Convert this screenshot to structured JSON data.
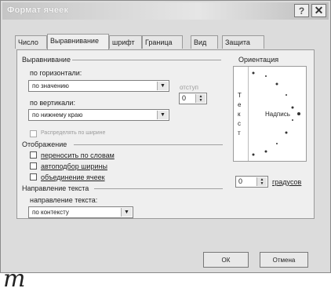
{
  "window": {
    "title": "Формат ячеек",
    "help_glyph": "?",
    "close_glyph": "✕"
  },
  "tabs": [
    {
      "label": "Число"
    },
    {
      "label": "Выравнивание"
    },
    {
      "label": "шрифт"
    },
    {
      "label": "Граница"
    },
    {
      "label": "Вид"
    },
    {
      "label": "Защита"
    }
  ],
  "alignment": {
    "section_title": "Выравнивание",
    "horizontal_label": "по горизонтали:",
    "horizontal_value": "по значению",
    "indent_label": "отступ",
    "indent_value": "0",
    "vertical_label": "по вертикали:",
    "vertical_value": "по нижнему краю",
    "justify_distributed_label": "Распределять по ширине"
  },
  "display": {
    "section_title": "Отображение",
    "wrap_text": "переносить по словам",
    "shrink_to_fit": "автоподбор ширины",
    "merge_cells": "объединение ячеек"
  },
  "text_direction": {
    "section_title": "Направление текста",
    "label": "направление текста:",
    "value": "по контексту"
  },
  "orientation": {
    "section_title": "Ориентация",
    "vertical_letters": [
      "Т",
      "е",
      "к",
      "с",
      "т"
    ],
    "caption_text": "Надпись",
    "degrees_value": "0",
    "degrees_label": "градусов"
  },
  "buttons": {
    "ok": "ОК",
    "cancel": "Отмена"
  },
  "overlay_mark": "m"
}
